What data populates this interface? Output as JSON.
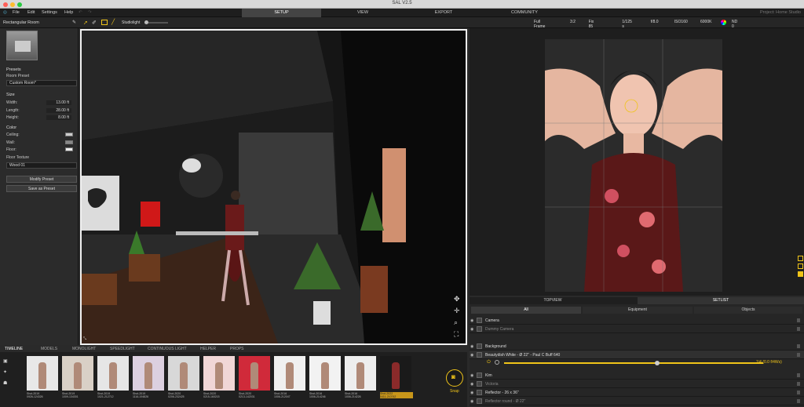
{
  "app": {
    "title": "SAL V2.5",
    "project": "Project: Home Studio"
  },
  "menu": [
    "File",
    "Edit",
    "Settings",
    "Help"
  ],
  "main_tabs": [
    {
      "label": "SETUP",
      "active": true
    },
    {
      "label": "VIEW",
      "active": false
    },
    {
      "label": "EXPORT",
      "active": false
    },
    {
      "label": "COMMUNITY",
      "active": false
    }
  ],
  "toolbar": {
    "studiolight_label": "Studiolight"
  },
  "camera_bar": [
    "Full Frame",
    "3:2",
    "Fix 85 mm",
    "1/125 s",
    "f/8.0",
    "ISO160",
    "6000K",
    "ND 0"
  ],
  "left_panel": {
    "header": "Rectangular Room",
    "presets_title": "Presets",
    "room_preset_label": "Room Preset",
    "room_preset_value": "Custom Room*",
    "size_title": "Size",
    "width_label": "Width:",
    "width_value": "13.00 ft",
    "length_label": "Length:",
    "length_value": "28.00 ft",
    "height_label": "Height:",
    "height_value": "8.00 ft",
    "color_title": "Color",
    "ceiling_label": "Ceiling:",
    "wall_label": "Wall:",
    "floor_label": "Floor:",
    "floor_texture_label": "Floor Texture",
    "floor_texture_value": "Wood 01",
    "modify_preset": "Modify Preset",
    "save_as_preset": "Save as Preset"
  },
  "bottom_tabs": [
    "TIMELINE",
    "MODELS",
    "MONOLIGHT",
    "SPEEDLIGHT",
    "CONTINUOUS LIGHT",
    "HELPER",
    "PROPS"
  ],
  "thumbnails": [
    {
      "name": "Shot-2019",
      "date": "0926-124326"
    },
    {
      "name": "Shot-2019",
      "date": "1009-134301"
    },
    {
      "name": "Shot-2019",
      "date": "1021-212712"
    },
    {
      "name": "Shot-2019",
      "date": "1116-194826"
    },
    {
      "name": "Shot-2020",
      "date": "0206-232425"
    },
    {
      "name": "Shot-2020",
      "date": "0215-160215"
    },
    {
      "name": "Shot-2020",
      "date": "0213-142031"
    },
    {
      "name": "Shot-2016",
      "date": "1006-212047"
    },
    {
      "name": "Shot-2016",
      "date": "1006-214246"
    },
    {
      "name": "Shot-2016",
      "date": "1006-214226"
    },
    {
      "name": "Shot-2022",
      "date": "0411-210742"
    }
  ],
  "snap_label": "Snap",
  "setlist": {
    "tabs": [
      "TOPVIEW",
      "SETLIST"
    ],
    "filters": [
      "All",
      "Equipment",
      "Objects"
    ],
    "rows": [
      "Camera",
      "Dummy Camera",
      "",
      "Background",
      "Beautydish White - Ø 22\" - Paul C Buff 640",
      "",
      "Kim",
      "Victoria",
      "Reflector - 26 x 36\"",
      "Reflector round - Ø 22\""
    ],
    "power_value": "1/4 (0.0 f/4Ws)"
  },
  "colors": {
    "accent": "#f0c419",
    "bg": "#2a2a2a"
  }
}
